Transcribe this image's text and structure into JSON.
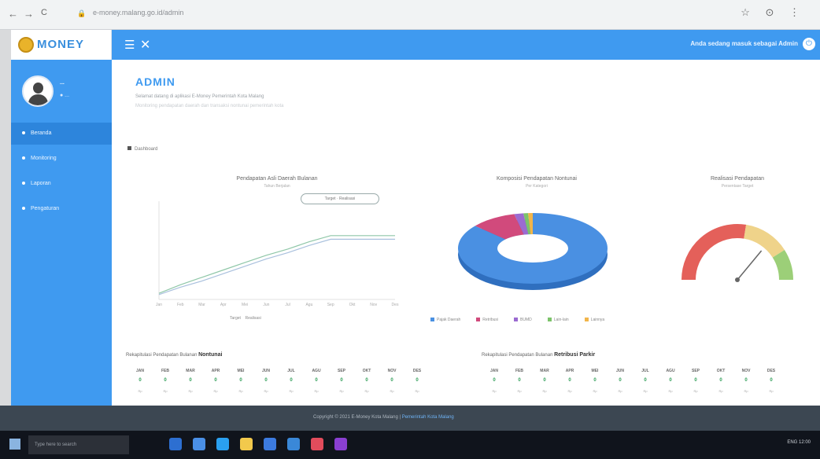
{
  "browser": {
    "back": "←",
    "forward": "→",
    "reload": "C",
    "url": "e-money.malang.go.id/admin",
    "tools": "☆ ⊙ ⋮"
  },
  "brand": {
    "logo_text": "MONEY"
  },
  "topbar": {
    "user_text": "Anda sedang masuk sebagai Admin"
  },
  "sidebar": {
    "user_name": "...",
    "user_sub": "● ...",
    "items": [
      {
        "label": "Beranda"
      },
      {
        "label": "Monitoring"
      },
      {
        "label": "Laporan"
      },
      {
        "label": "Pengaturan"
      }
    ]
  },
  "content": {
    "title": "ADMIN",
    "subtitle1": "Selamat datang di aplikasi E-Money Pemerintah Kota Malang",
    "subtitle2": "Monitoring pendapatan daerah dan transaksi nontunai pemerintah kota",
    "section_label": "Dashboard"
  },
  "charts": {
    "line_title": "Pendapatan Asli Daerah Bulanan",
    "line_sub": "Tahun Berjalan",
    "donut_title": "Komposisi Pendapatan Nontunai",
    "donut_sub": "Per Kategori",
    "gauge_title": "Realisasi Pendapatan",
    "gauge_sub": "Persentase Target"
  },
  "chart_data": [
    {
      "type": "line",
      "title": "Pendapatan Asli Daerah Bulanan",
      "x": [
        "Jan",
        "Feb",
        "Mar",
        "Apr",
        "Mei",
        "Jun",
        "Jul",
        "Agu",
        "Sep",
        "Okt",
        "Nov",
        "Des"
      ],
      "series": [
        {
          "name": "Target",
          "values": [
            5,
            12,
            18,
            24,
            30,
            36,
            41,
            47,
            52,
            52,
            52,
            52
          ]
        },
        {
          "name": "Realisasi",
          "values": [
            4,
            10,
            15,
            21,
            27,
            33,
            38,
            44,
            49,
            49,
            49,
            49
          ]
        }
      ],
      "ylim": [
        0,
        80
      ]
    },
    {
      "type": "pie",
      "title": "Komposisi Pendapatan Nontunai",
      "categories": [
        "Pajak",
        "Retribusi",
        "BUMD",
        "Lain-lain",
        "Lainnya"
      ],
      "values": [
        86,
        10,
        2,
        1,
        1
      ]
    },
    {
      "type": "gauge",
      "title": "Realisasi Pendapatan",
      "value": 72,
      "min": 0,
      "max": 100
    }
  ],
  "legend": [
    {
      "label": "Pajak Daerah",
      "color": "#4a90e2"
    },
    {
      "label": "Retribusi",
      "color": "#d14a7c"
    },
    {
      "label": "BUMD",
      "color": "#9b6bd1"
    },
    {
      "label": "Lain-lain",
      "color": "#7cc36a"
    },
    {
      "label": "Lainnya",
      "color": "#f2b54a"
    }
  ],
  "table_left": {
    "title_prefix": "Rekapitulasi Pendapatan Bulanan",
    "title_bold": "Nontunai",
    "months": [
      "JAN",
      "FEB",
      "MAR",
      "APR",
      "MEI",
      "JUN",
      "JUL",
      "AGU",
      "SEP",
      "OKT",
      "NOV",
      "DES"
    ],
    "values": [
      "0",
      "0",
      "0",
      "0",
      "0",
      "0",
      "0",
      "0",
      "0",
      "0",
      "0",
      "0"
    ],
    "details": [
      "Rp",
      "Rp",
      "Rp",
      "Rp",
      "Rp",
      "Rp",
      "Rp",
      "Rp",
      "Rp",
      "Rp",
      "Rp",
      "Rp"
    ]
  },
  "table_right": {
    "title_prefix": "Rekapitulasi Pendapatan Bulanan",
    "title_bold": "Retribusi Parkir",
    "months": [
      "JAN",
      "FEB",
      "MAR",
      "APR",
      "MEI",
      "JUN",
      "JUL",
      "AGU",
      "SEP",
      "OKT",
      "NOV",
      "DES"
    ],
    "values": [
      "0",
      "0",
      "0",
      "0",
      "0",
      "0",
      "0",
      "0",
      "0",
      "0",
      "0",
      "0"
    ],
    "details": [
      "Rp",
      "Rp",
      "Rp",
      "Rp",
      "Rp",
      "Rp",
      "Rp",
      "Rp",
      "Rp",
      "Rp",
      "Rp",
      "Rp"
    ]
  },
  "footer": {
    "text": "Copyright © 2021 E-Money Kota Malang",
    "link": "Pemerintah Kota Malang"
  },
  "taskbar": {
    "search": "Type here to search",
    "tray": "ENG  12:00"
  }
}
